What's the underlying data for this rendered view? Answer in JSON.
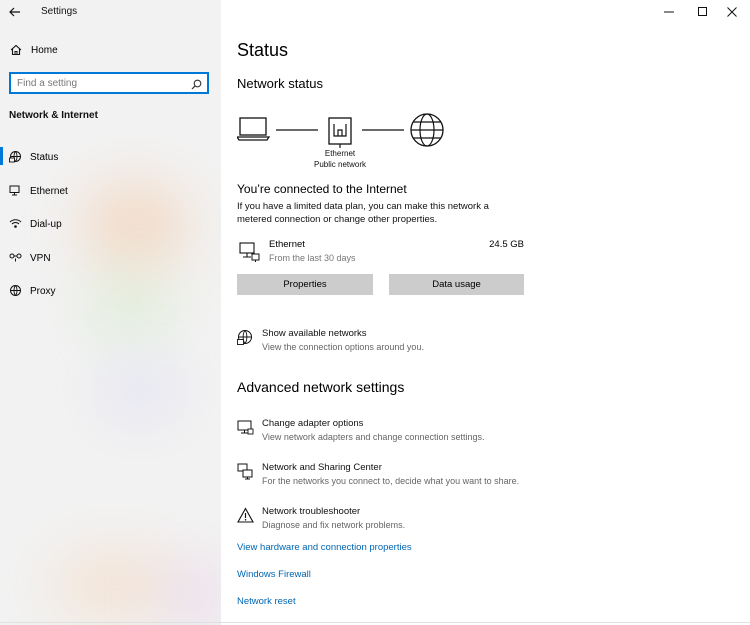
{
  "window": {
    "title": "Settings"
  },
  "sidebar": {
    "home_label": "Home",
    "search_placeholder": "Find a setting",
    "section_title": "Network & Internet",
    "items": [
      {
        "label": "Status",
        "icon": "status-icon"
      },
      {
        "label": "Ethernet",
        "icon": "ethernet-icon"
      },
      {
        "label": "Dial-up",
        "icon": "dialup-icon"
      },
      {
        "label": "VPN",
        "icon": "vpn-icon"
      },
      {
        "label": "Proxy",
        "icon": "proxy-icon"
      }
    ]
  },
  "main": {
    "page_title": "Status",
    "network_status_title": "Network status",
    "diagram": {
      "line1": "Ethernet",
      "line2": "Public network"
    },
    "connected_title": "You’re connected to the Internet",
    "connected_desc": "If you have a limited data plan, you can make this network a metered connection or change other properties.",
    "connection": {
      "name": "Ethernet",
      "subtitle": "From the last 30 days",
      "usage": "24.5 GB"
    },
    "buttons": {
      "properties": "Properties",
      "data_usage": "Data usage"
    },
    "show_networks": {
      "title": "Show available networks",
      "desc": "View the connection options around you."
    },
    "advanced_title": "Advanced network settings",
    "advanced_items": [
      {
        "title": "Change adapter options",
        "desc": "View network adapters and change connection settings.",
        "icon": "adapter-icon"
      },
      {
        "title": "Network and Sharing Center",
        "desc": "For the networks you connect to, decide what you want to share.",
        "icon": "sharing-center-icon"
      },
      {
        "title": "Network troubleshooter",
        "desc": "Diagnose and fix network problems.",
        "icon": "warning-icon"
      }
    ],
    "links": {
      "hardware": "View hardware and connection properties",
      "firewall": "Windows Firewall",
      "reset": "Network reset"
    }
  },
  "colors": {
    "accent": "#0078d7",
    "link": "#0066b4",
    "button": "#cccccc",
    "sidebar_bg": "#f2f2f2"
  }
}
